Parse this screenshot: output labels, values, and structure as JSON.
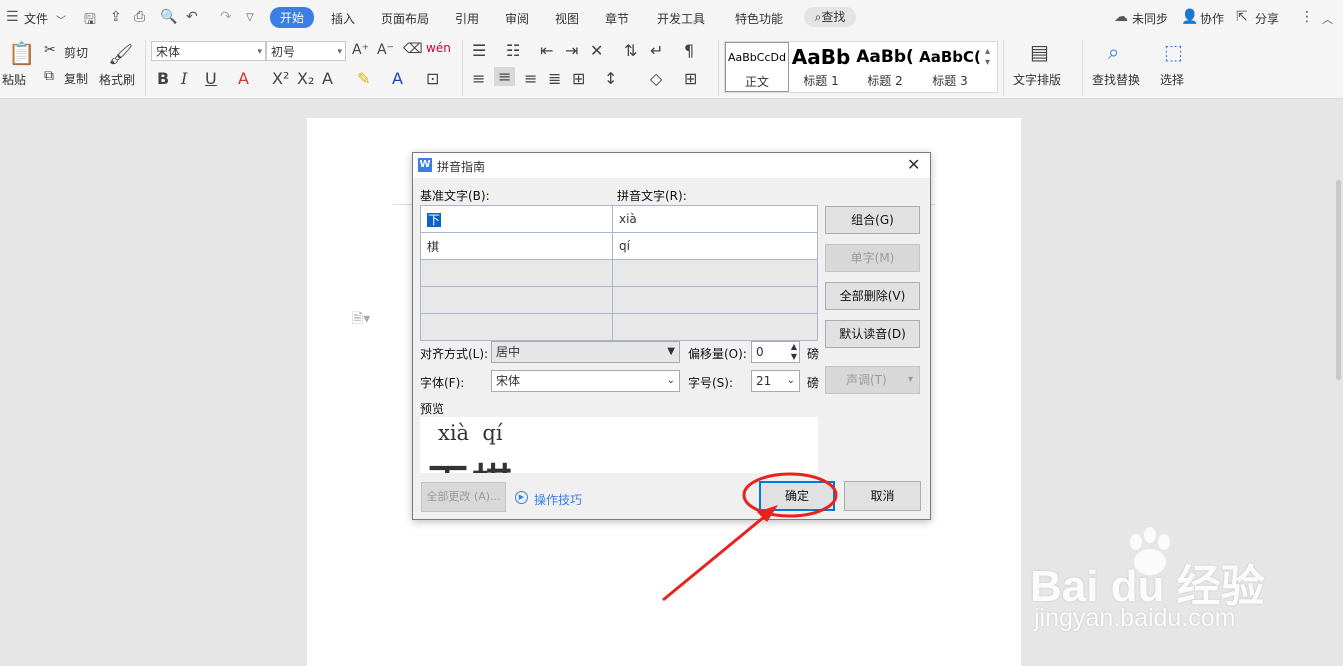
{
  "menubar": {
    "file_label": "文件",
    "tabs": [
      "开始",
      "插入",
      "页面布局",
      "引用",
      "审阅",
      "视图",
      "章节",
      "开发工具",
      "特色功能"
    ],
    "search_label": "查找",
    "sync_label": "未同步",
    "collab_label": "协作",
    "share_label": "分享"
  },
  "ribbon": {
    "paste_label": "粘贴",
    "cut_label": "剪切",
    "copy_label": "复制",
    "format_painter_label": "格式刷",
    "font_name": "宋体",
    "font_size": "初号",
    "styles": [
      {
        "sample": "AaBbCcDd",
        "name": "正文"
      },
      {
        "sample": "AaBb",
        "name": "标题 1"
      },
      {
        "sample": "AaBb(",
        "name": "标题 2"
      },
      {
        "sample": "AaBbC(",
        "name": "标题 3"
      }
    ],
    "text_layout_label": "文字排版",
    "find_replace_label": "查找替换",
    "select_label": "选择"
  },
  "dialog": {
    "title": "拼音指南",
    "base_text_header": "基准文字(B):",
    "pinyin_text_header": "拼音文字(R):",
    "rows": [
      {
        "base": "下",
        "pinyin": "xià"
      },
      {
        "base": "棋",
        "pinyin": "qí"
      },
      {
        "base": "",
        "pinyin": ""
      },
      {
        "base": "",
        "pinyin": ""
      },
      {
        "base": "",
        "pinyin": ""
      }
    ],
    "alignment_label": "对齐方式(L):",
    "alignment_value": "居中",
    "offset_label": "偏移量(O):",
    "offset_value": "0",
    "offset_unit": "磅",
    "font_label": "字体(F):",
    "font_value": "宋体",
    "size_label": "字号(S):",
    "size_value": "21",
    "size_unit": "磅",
    "preview_label": "预览",
    "preview_pinyin": "xià  qí",
    "preview_chars": "下棋",
    "buttons": {
      "group": "组合(G)",
      "mono": "单字(M)",
      "clear_all": "全部删除(V)",
      "default_reading": "默认读音(D)",
      "tone": "声调(T)",
      "change_all": "全部更改 (A)...",
      "tips": "操作技巧",
      "ok": "确定",
      "cancel": "取消"
    }
  },
  "watermark": {
    "brand": "Bai du 经验",
    "url": "jingyan.baidu.com"
  },
  "colors": {
    "accent": "#3a7ee4",
    "annotation_red": "#e8221d",
    "selection": "#0a64c8"
  }
}
